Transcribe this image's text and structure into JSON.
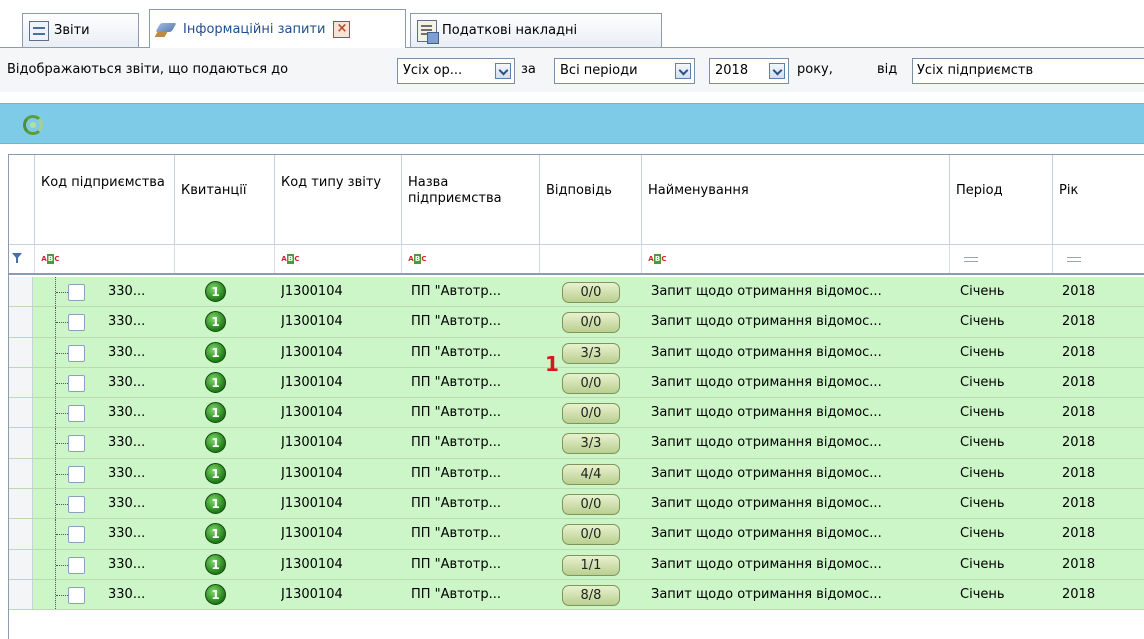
{
  "tabs": [
    {
      "label": "Звіти",
      "icon": "report-icon",
      "active": false
    },
    {
      "label": "Інформаційні запити",
      "icon": "wand-icon",
      "active": true
    },
    {
      "label": "Податкові накладні",
      "icon": "invoice-icon",
      "active": false
    }
  ],
  "filter": {
    "prefix": "Відображаються звіти, що подаються до",
    "org_value": "Усіх ор...",
    "za": "за",
    "period_value": "Всі періоди",
    "year_value": "2018",
    "roku": "року,",
    "vid": "від",
    "enterprise_value": "Усіх підприємств"
  },
  "columns": {
    "kod_pidpr": "Код підприємства",
    "kvytantsii": "Квитанції",
    "kod_typu": "Код типу звіту",
    "nazva": "Назва підприємства",
    "vidpovid": "Відповідь",
    "naimenuvannia": "Найменування",
    "period": "Період",
    "rik": "Рік"
  },
  "rows": [
    {
      "code": "330...",
      "type_code": "J1300104",
      "name": "ПП \"Автотр...",
      "answer": "0/0",
      "title": "Запит щодо отримання відомос...",
      "period": "Січень",
      "year": "2018"
    },
    {
      "code": "330...",
      "type_code": "J1300104",
      "name": "ПП \"Автотр...",
      "answer": "0/0",
      "title": "Запит щодо отримання відомос...",
      "period": "Січень",
      "year": "2018"
    },
    {
      "code": "330...",
      "type_code": "J1300104",
      "name": "ПП \"Автотр...",
      "answer": "3/3",
      "title": "Запит щодо отримання відомос...",
      "period": "Січень",
      "year": "2018"
    },
    {
      "code": "330...",
      "type_code": "J1300104",
      "name": "ПП \"Автотр...",
      "answer": "0/0",
      "title": "Запит щодо отримання відомос...",
      "period": "Січень",
      "year": "2018"
    },
    {
      "code": "330...",
      "type_code": "J1300104",
      "name": "ПП \"Автотр...",
      "answer": "0/0",
      "title": "Запит щодо отримання відомос...",
      "period": "Січень",
      "year": "2018"
    },
    {
      "code": "330...",
      "type_code": "J1300104",
      "name": "ПП \"Автотр...",
      "answer": "3/3",
      "title": "Запит щодо отримання відомос...",
      "period": "Січень",
      "year": "2018"
    },
    {
      "code": "330...",
      "type_code": "J1300104",
      "name": "ПП \"Автотр...",
      "answer": "4/4",
      "title": "Запит щодо отримання відомос...",
      "period": "Січень",
      "year": "2018"
    },
    {
      "code": "330...",
      "type_code": "J1300104",
      "name": "ПП \"Автотр...",
      "answer": "0/0",
      "title": "Запит щодо отримання відомос...",
      "period": "Січень",
      "year": "2018"
    },
    {
      "code": "330...",
      "type_code": "J1300104",
      "name": "ПП \"Автотр...",
      "answer": "0/0",
      "title": "Запит щодо отримання відомос...",
      "period": "Січень",
      "year": "2018"
    },
    {
      "code": "330...",
      "type_code": "J1300104",
      "name": "ПП \"Автотр...",
      "answer": "1/1",
      "title": "Запит щодо отримання відомос...",
      "period": "Січень",
      "year": "2018"
    },
    {
      "code": "330...",
      "type_code": "J1300104",
      "name": "ПП \"Автотр...",
      "answer": "8/8",
      "title": "Запит щодо отримання відомос...",
      "period": "Січень",
      "year": "2018"
    }
  ],
  "annotation": "1",
  "colors": {
    "row_bg": "#ccf5c8",
    "toolbar_bg": "#7ecbe8",
    "marker": "#d11b1b"
  }
}
